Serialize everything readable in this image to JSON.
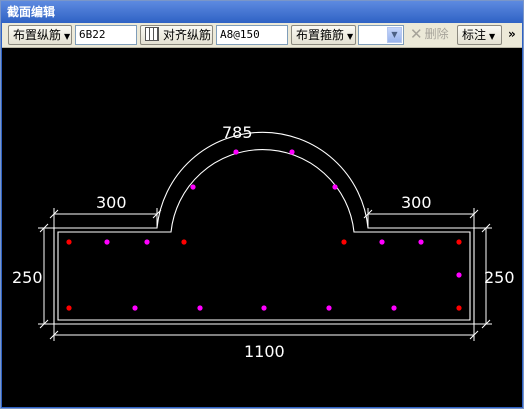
{
  "window": {
    "title": "截面编辑"
  },
  "toolbar": {
    "longitudinal_rebar_menu": "布置纵筋",
    "longitudinal_rebar_value": "6B22",
    "align_rebar_label": "对齐纵筋",
    "stirrup_value": "A8@150",
    "stirrup_menu": "布置箍筋",
    "combo_value": "",
    "delete_label": "删除",
    "annotate_menu": "标注",
    "overflow_glyph": "»"
  },
  "drawing": {
    "dimensions": {
      "arc": "785",
      "top_left": "300",
      "top_right": "300",
      "left_height": "250",
      "right_height": "250",
      "bottom_width": "1100"
    },
    "rebar_colors": {
      "corner": "#ff0000",
      "intermediate": "#ff00ff"
    },
    "outline_color": "#ffffff"
  }
}
